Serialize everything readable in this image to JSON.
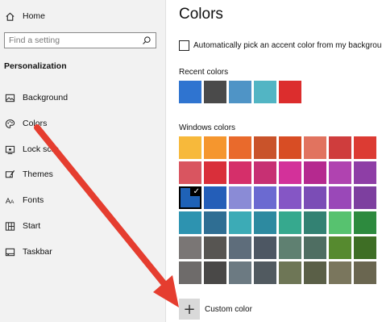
{
  "sidebar": {
    "home_label": "Home",
    "search_placeholder": "Find a setting",
    "section_title": "Personalization",
    "items": [
      {
        "label": "Background",
        "icon": "image-icon"
      },
      {
        "label": "Colors",
        "icon": "palette-icon"
      },
      {
        "label": "Lock scre",
        "icon": "lock-screen-icon"
      },
      {
        "label": "Themes",
        "icon": "brush-icon"
      },
      {
        "label": "Fonts",
        "icon": "font-icon"
      },
      {
        "label": "Start",
        "icon": "start-grid-icon"
      },
      {
        "label": "Taskbar",
        "icon": "taskbar-icon"
      }
    ]
  },
  "main": {
    "title": "Colors",
    "auto_accent_label": "Automatically pick an accent color from my background",
    "auto_accent_checked": false,
    "recent_label": "Recent colors",
    "recent_colors": [
      "#2f74d0",
      "#4a4a4a",
      "#4f94c6",
      "#52b5c4",
      "#dc2d2d"
    ],
    "windows_label": "Windows colors",
    "windows_colors": [
      [
        "#f7b93b",
        "#f5962e",
        "#e96a2c",
        "#c9532a",
        "#d84d24",
        "#e1735f",
        "#cf3d3d",
        "#dc3b33"
      ],
      [
        "#d95560",
        "#d92f3a",
        "#d52f6a",
        "#c73073",
        "#d3319a",
        "#b5298f",
        "#b043b0",
        "#8e3ea6"
      ],
      [
        "#1f62b7",
        "#245eb8",
        "#8a8bd6",
        "#6b6ad1",
        "#8556c5",
        "#7b4db6",
        "#9a48b8",
        "#7d3f9f"
      ],
      [
        "#2d93b0",
        "#2f6e93",
        "#3cabb6",
        "#2d8aa0",
        "#36a98e",
        "#338273",
        "#57c26f",
        "#2d8a3e"
      ],
      [
        "#7a7675",
        "#575552",
        "#5e6d7b",
        "#4d5763",
        "#5f8071",
        "#4f6e62",
        "#568a2f",
        "#3e6e25"
      ],
      [
        "#6e6b6a",
        "#494847",
        "#6c7a82",
        "#515a60",
        "#6e7656",
        "#5a5f47",
        "#7a765d",
        "#6a6650"
      ]
    ],
    "selected_color": {
      "row": 2,
      "col": 0
    },
    "selected_mark": "✓",
    "custom_label": "Custom color",
    "custom_plus": "+"
  },
  "colors": {
    "annotation_arrow": "#e53d2f",
    "sidebar_bg": "#f2f2f2"
  }
}
